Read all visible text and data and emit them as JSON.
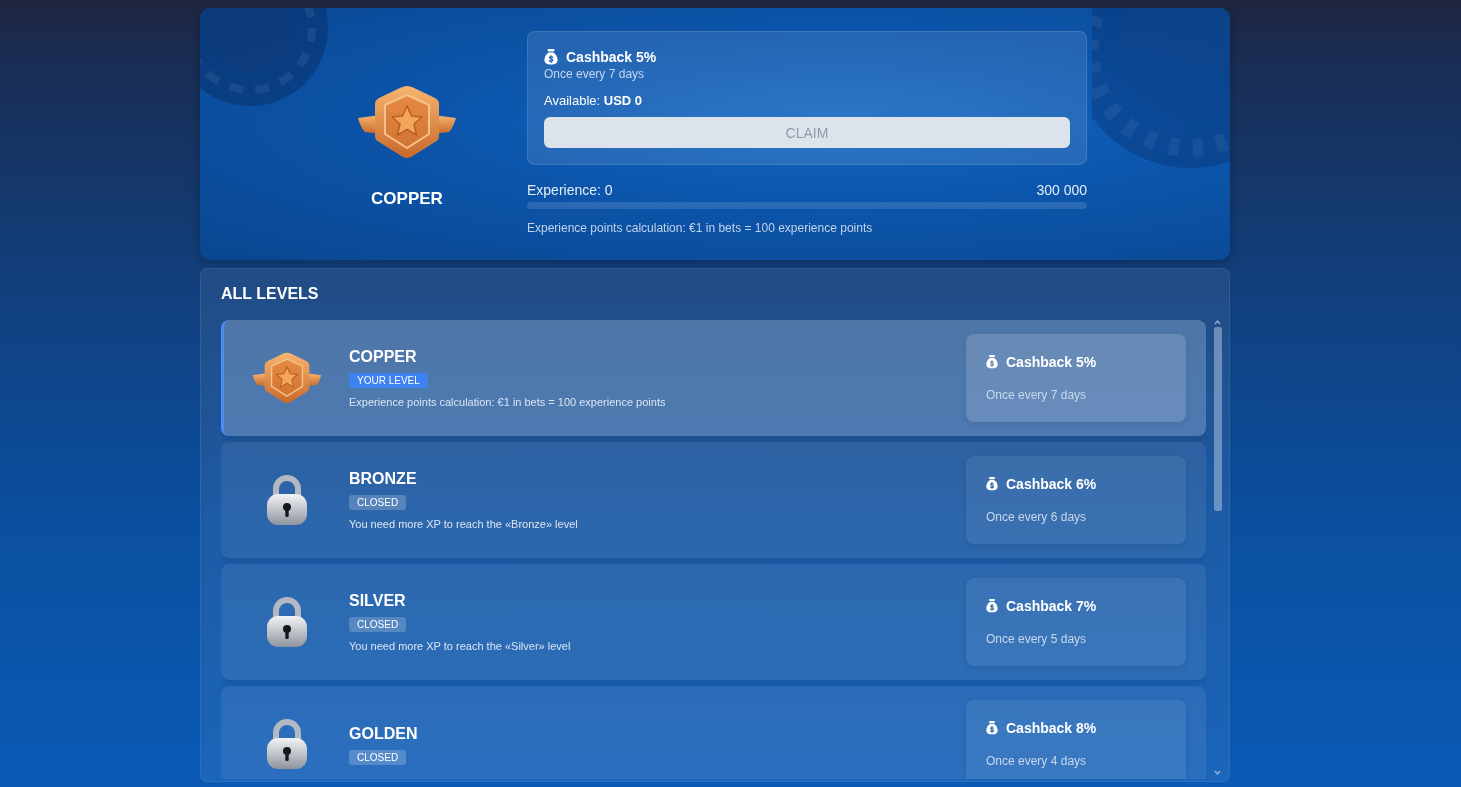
{
  "hero": {
    "level_name": "COPPER",
    "cashback": {
      "title": "Cashback 5%",
      "subtitle": "Once every 7 days",
      "available": "Available: **USD 0**",
      "claim_button": {
        "label": "CLAIM",
        "disabled": true
      }
    },
    "experience": {
      "label": "Experience: 0",
      "target": "300 000",
      "level": 0,
      "note": "Experience points calculation: €1 in bets = 100 experience points"
    }
  },
  "levels_panel": {
    "title": "ALL LEVELS",
    "levels": [
      {
        "kind": "current",
        "selected": true,
        "name": "COPPER",
        "badge": "YOUR LEVEL",
        "description": "Experience points calculation: €1 in bets = 100 experience points",
        "cashback_title": "Cashback 5%",
        "cashback_subtitle": "Once every 7 days"
      },
      {
        "kind": "locked",
        "selected": false,
        "name": "BRONZE",
        "badge": "CLOSED",
        "description": "You need more XP to reach the «Bronze» level",
        "cashback_title": "Cashback 6%",
        "cashback_subtitle": "Once every 6 days"
      },
      {
        "kind": "locked",
        "selected": false,
        "name": "SILVER",
        "badge": "CLOSED",
        "description": "You need more XP to reach the «Silver» level",
        "cashback_title": "Cashback 7%",
        "cashback_subtitle": "Once every 5 days"
      },
      {
        "kind": "locked",
        "selected": false,
        "name": "GOLDEN",
        "badge": "CLOSED",
        "cashback_title": "Cashback 8%",
        "cashback_subtitle": "Once every 4 days"
      }
    ]
  }
}
